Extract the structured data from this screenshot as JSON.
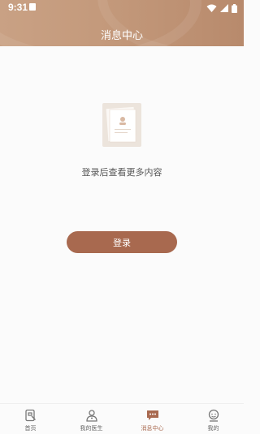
{
  "status_bar": {
    "time": "9:31"
  },
  "header": {
    "title": "消息中心"
  },
  "empty_state": {
    "message": "登录后查看更多内容"
  },
  "login": {
    "label": "登录"
  },
  "tabs": [
    {
      "label": "首页",
      "icon": "home-icon",
      "active": false
    },
    {
      "label": "我的医生",
      "icon": "doctor-icon",
      "active": false
    },
    {
      "label": "消息中心",
      "icon": "message-icon",
      "active": true
    },
    {
      "label": "我的",
      "icon": "profile-icon",
      "active": false
    }
  ],
  "colors": {
    "accent": "#a8694f",
    "header": "#c49a7c"
  }
}
